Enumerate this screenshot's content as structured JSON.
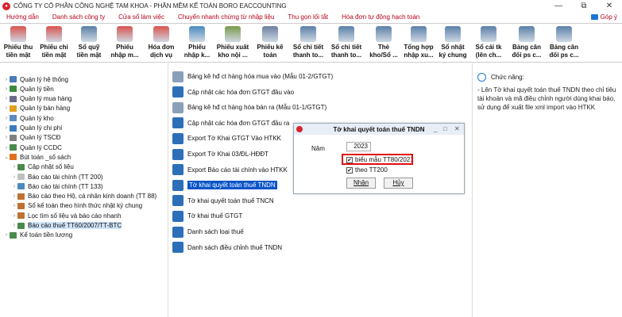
{
  "window": {
    "title": "CÔNG TY CỔ PHẦN CÔNG NGHỆ TAM KHOA - PHẦN MỀM KẾ TOÁN BORO EACCOUNTING",
    "controls": [
      "—",
      "⧉",
      "✕"
    ]
  },
  "menu": {
    "items": [
      "Hướng dẫn",
      "Danh sách công ty",
      "Cửa sổ làm việc",
      "Chuyển nhanh chứng từ nhập liệu",
      "Thu gọn lối tắt",
      "Hóa đơn tự động hạch toán"
    ],
    "help": "Góp ý"
  },
  "toolbar": {
    "buttons": [
      {
        "line1": "Phiếu thu",
        "line2": "tiền mặt",
        "icon": "receipt-icon"
      },
      {
        "line1": "Phiếu chi",
        "line2": "tiền mặt",
        "icon": "payment-icon"
      },
      {
        "line1": "Sổ quỹ",
        "line2": "tiền mặt",
        "icon": "cashbook-icon"
      },
      {
        "line1": "Phiếu",
        "line2": "nhập m...",
        "icon": "import-slip-icon"
      },
      {
        "line1": "Hóa đơn",
        "line2": "dịch vụ",
        "icon": "invoice-icon"
      },
      {
        "line1": "Phiếu",
        "line2": "nhập k...",
        "icon": "stock-in-icon"
      },
      {
        "line1": "Phiếu xuất",
        "line2": "kho nội ...",
        "icon": "stock-out-icon"
      },
      {
        "line1": "Phiếu kế",
        "line2": "toán",
        "icon": "accounting-slip-icon"
      },
      {
        "line1": "Sổ chi tiết",
        "line2": "thanh to...",
        "icon": "ledger-icon"
      },
      {
        "line1": "Sổ chi tiết",
        "line2": "thanh to...",
        "icon": "ledger-icon"
      },
      {
        "line1": "Thẻ",
        "line2": "kho/Sổ ...",
        "icon": "stock-card-icon"
      },
      {
        "line1": "Tổng hợp",
        "line2": "nhập xu...",
        "icon": "summary-icon"
      },
      {
        "line1": "Sổ nhật",
        "line2": "ký chung",
        "icon": "journal-icon"
      },
      {
        "line1": "Sổ cái tk",
        "line2": "(lên ch...",
        "icon": "general-ledger-icon"
      },
      {
        "line1": "Bảng cân",
        "line2": "đối ps c...",
        "icon": "balance-icon"
      },
      {
        "line1": "Bảng cân",
        "line2": "đối ps c...",
        "icon": "balance-icon"
      }
    ]
  },
  "tree": [
    {
      "label": "Quản lý hệ thống",
      "arrow": "›",
      "indent": 0,
      "color": "#4a7ab8"
    },
    {
      "label": "Quản lý tiền",
      "arrow": "›",
      "indent": 0,
      "color": "#3b8a3b"
    },
    {
      "label": "Quản lý mua hàng",
      "arrow": "›",
      "indent": 0,
      "color": "#6a6a8a"
    },
    {
      "label": "Quản lý bán hàng",
      "arrow": "›",
      "indent": 0,
      "color": "#e0a020"
    },
    {
      "label": "Quản lý kho",
      "arrow": "›",
      "indent": 0,
      "color": "#5a8abf"
    },
    {
      "label": "Quản lý chi phí",
      "arrow": "›",
      "indent": 0,
      "color": "#3a7ac0"
    },
    {
      "label": "Quản lý TSCĐ",
      "arrow": "›",
      "indent": 0,
      "color": "#808080"
    },
    {
      "label": "Quản lý CCDC",
      "arrow": "›",
      "indent": 0,
      "color": "#4a8a4a"
    },
    {
      "label": "Bút toán _số sách",
      "arrow": "⌄",
      "indent": 0,
      "color": "#e07020"
    },
    {
      "label": "Cập nhật số liệu",
      "arrow": "›",
      "indent": 1,
      "color": "#4a8a4a"
    },
    {
      "label": "Báo cáo tài chính (TT 200)",
      "arrow": "›",
      "indent": 1,
      "color": "#c0c0c0"
    },
    {
      "label": "Báo cáo tài chính (TT 133)",
      "arrow": "›",
      "indent": 1,
      "color": "#4a8ac0"
    },
    {
      "label": "Báo cáo theo Hộ, cá nhân kinh doanh (TT 88)",
      "arrow": "›",
      "indent": 1,
      "color": "#c07030"
    },
    {
      "label": "Sổ kế toán theo hình thức nhật ký chung",
      "arrow": "›",
      "indent": 1,
      "color": "#c07030"
    },
    {
      "label": "Lọc tìm số liệu và báo cáo nhanh",
      "arrow": "›",
      "indent": 1,
      "color": "#c07030"
    },
    {
      "label": "Báo cáo thuế TT60/2007/TT-BTC",
      "arrow": "›",
      "indent": 1,
      "color": "#4a8a4a",
      "selected": true
    },
    {
      "label": "Kế toán tiền lương",
      "arrow": "›",
      "indent": 0,
      "color": "#4a8a4a"
    }
  ],
  "tasks": [
    {
      "label": "Bảng kê hđ ct hàng hóa mua vào (Mẫu 01-2/GTGT)",
      "color": "#8aa0b8"
    },
    {
      "label": "Cập nhật các hóa đơn GTGT đầu vào",
      "color": "#2c6fb8"
    },
    {
      "label": "Bảng kê hđ ct hàng hóa bán ra (Mẫu 01-1/GTGT)",
      "color": "#8aa0b8"
    },
    {
      "label": "Cập nhật các hóa đơn GTGT đầu ra",
      "color": "#2c6fb8"
    },
    {
      "label": "Export Tờ Khai GTGT Vào HTKK",
      "color": "#2c6fb8"
    },
    {
      "label": "Export Tờ Khai 03/ĐL-HĐĐT",
      "color": "#2c6fb8"
    },
    {
      "label": "Export Báo cáo tài chính vào HTKK",
      "color": "#2c6fb8"
    },
    {
      "label": "Tờ khai quyết toán thuế TNDN",
      "color": "#2c6fb8",
      "highlight": true
    },
    {
      "label": "Tờ khai quyết toán thuế TNCN",
      "color": "#2c6fb8"
    },
    {
      "label": "Tờ khai thuế GTGT",
      "color": "#2c6fb8"
    },
    {
      "label": "Danh sách loại thuế",
      "color": "#2c6fb8"
    },
    {
      "label": "Danh sách điều chỉnh thuế TNDN",
      "color": "#2c6fb8"
    }
  ],
  "help_panel": {
    "title": "Chức năng:",
    "body": "- Lên Tờ khai quyết toán thuế TNDN theo chỉ tiêu tài khoản và mã điều chỉnh người dùng khai báo, sử dụng để xuất file xml import vào HTKK"
  },
  "dialog": {
    "title": "Tờ khai quyết toán thuế TNDN",
    "year_label": "Năm",
    "year_value": "2023",
    "check1_label": "biểu mẫu TT80/2021",
    "check1_checked": "✔",
    "check2_label": "theo TT200",
    "check2_checked": "✔",
    "ok_label": "Nhận",
    "cancel_label": "Hủy",
    "controls": [
      "_",
      "□",
      "✕"
    ]
  }
}
